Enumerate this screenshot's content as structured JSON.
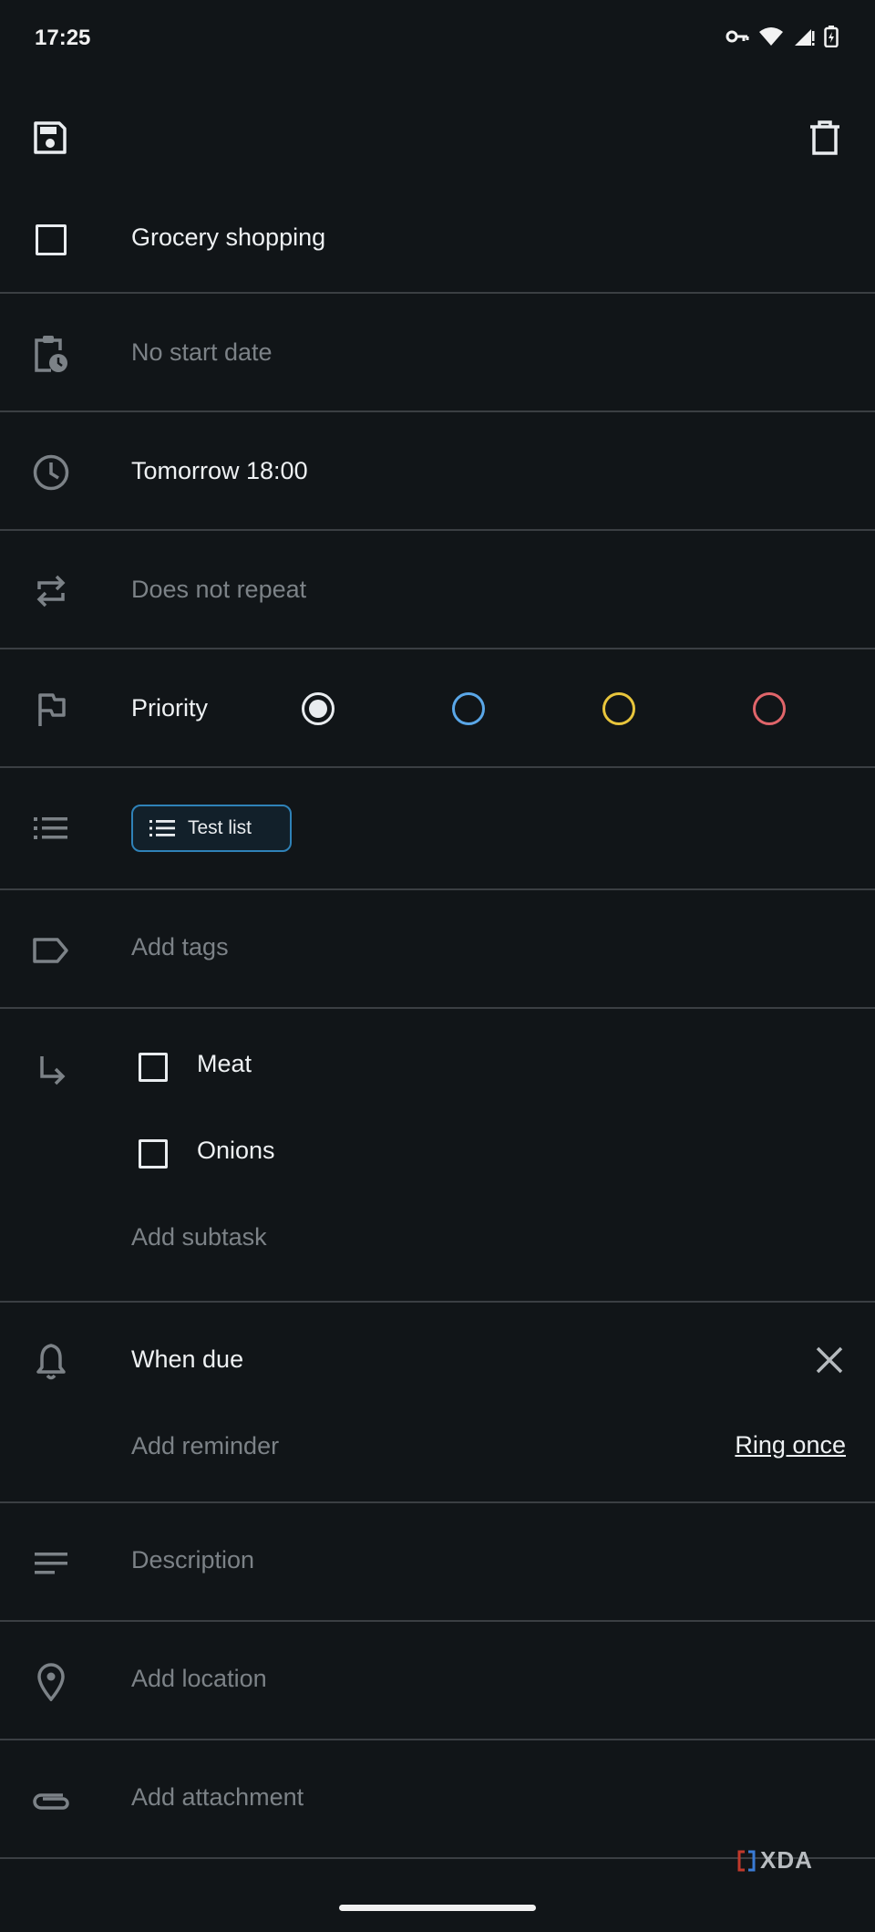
{
  "status_bar": {
    "time": "17:25",
    "icons": [
      "vpn-key-icon",
      "wifi-icon",
      "signal-icon",
      "battery-charging-icon"
    ]
  },
  "toolbar": {
    "save_icon": "save-icon",
    "delete_icon": "trash-icon"
  },
  "task": {
    "title": "Grocery shopping"
  },
  "fields": {
    "start_date": "No start date",
    "due_date": "Tomorrow 18:00",
    "repeat": "Does not repeat",
    "priority_label": "Priority",
    "priority_colors": [
      "#e9ecef",
      "#5aa7e8",
      "#e8c53c",
      "#e0656a"
    ],
    "priority_selected": 0,
    "list_chip": "Test list",
    "tags": "Add tags",
    "subtasks": [
      "Meat",
      "Onions"
    ],
    "add_subtask": "Add subtask",
    "reminder_title": "When due",
    "add_reminder": "Add reminder",
    "ring_mode": "Ring once",
    "description": "Description",
    "location": "Add location",
    "attachment": "Add attachment"
  },
  "watermark": {
    "text": "XDA"
  }
}
